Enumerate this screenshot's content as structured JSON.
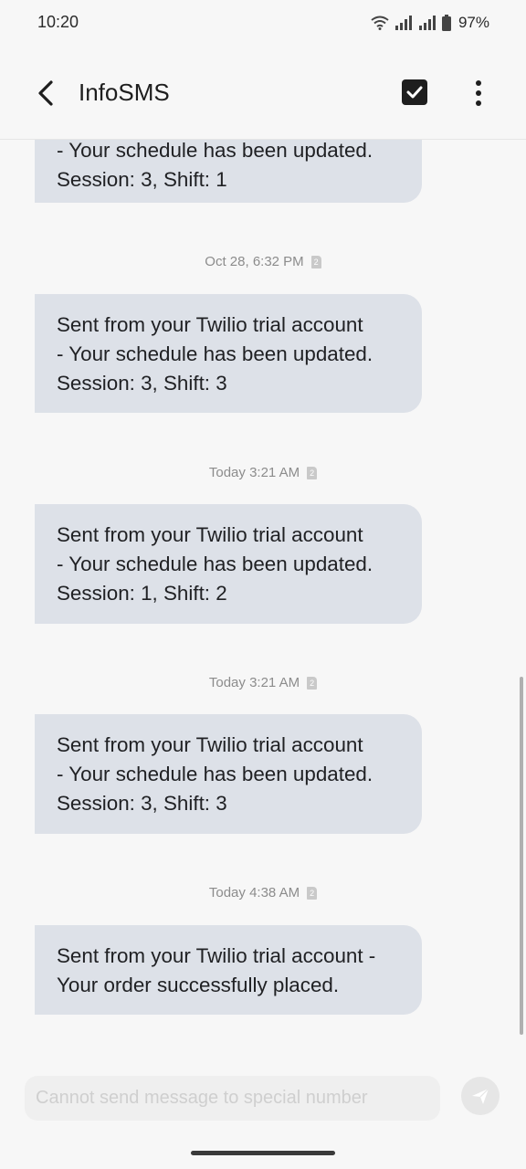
{
  "status_bar": {
    "time": "10:20",
    "battery": "97%"
  },
  "header": {
    "title": "InfoSMS"
  },
  "messages": [
    {
      "text": "- Your schedule has been updated.\nSession: 3, Shift: 1"
    },
    {
      "timestamp": "Oct 28, 6:32 PM",
      "sim": "2",
      "text": "Sent from your Twilio trial account\n- Your schedule has been updated.\nSession: 3, Shift: 3"
    },
    {
      "timestamp": "Today 3:21 AM",
      "sim": "2",
      "text": "Sent from your Twilio trial account\n- Your schedule has been updated.\nSession: 1, Shift: 2"
    },
    {
      "timestamp": "Today 3:21 AM",
      "sim": "2",
      "text": "Sent from your Twilio trial account\n- Your schedule has been updated.\nSession: 3, Shift: 3"
    },
    {
      "timestamp": "Today 4:38 AM",
      "sim": "2",
      "text": "Sent from your Twilio trial account -\nYour order successfully placed."
    }
  ],
  "composer": {
    "placeholder": "Cannot send message to special number"
  },
  "colors": {
    "background": "#f7f7f7",
    "bubble": "#dde1e8",
    "timestamp": "#8c8c8c"
  }
}
